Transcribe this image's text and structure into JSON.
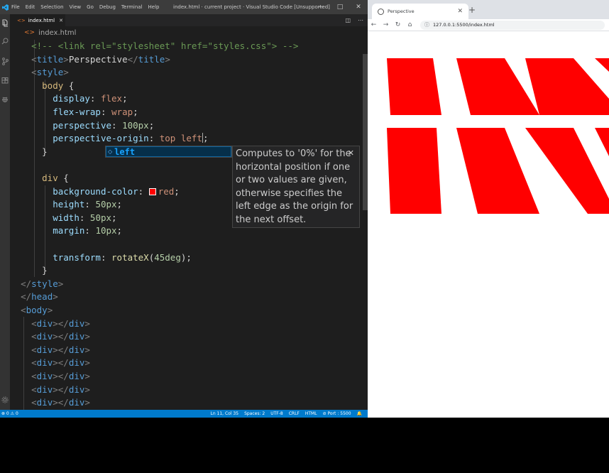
{
  "vscode": {
    "menu": [
      "File",
      "Edit",
      "Selection",
      "View",
      "Go",
      "Debug",
      "Terminal",
      "Help"
    ],
    "window_title": "index.html · current project · Visual Studio Code [Unsupported]",
    "tab": {
      "label": "index.html"
    },
    "breadcrumb": "index.html",
    "code_lines": [
      "    <!-- <link rel=\"stylesheet\" href=\"styles.css\"> -->",
      "    <title>Perspective</title>",
      "    <style>",
      "      body {",
      "        display: flex;",
      "        flex-wrap: wrap;",
      "        perspective: 100px;",
      "        perspective-origin: top left;",
      "      }",
      "",
      "      div {",
      "        background-color: red;",
      "        height: 50px;",
      "        width: 50px;",
      "        margin: 10px;",
      "",
      "        transform: rotateX(45deg);",
      "      }",
      "  </style>",
      "  </head>",
      "  <body>",
      "    <div></div>",
      "    <div></div>",
      "    <div></div>",
      "    <div></div>",
      "    <div></div>",
      "    <div></div>",
      "    <div></div>"
    ],
    "suggestion": {
      "label": "left",
      "doc": "Computes to '0%' for the horizontal position if one or two values are given, otherwise specifies the left edge as the origin for the next offset."
    },
    "status": {
      "left": "⊗ 0  ⚠ 0",
      "position": "Ln 11, Col 35",
      "spaces": "Spaces: 2",
      "encoding": "UTF-8",
      "eol": "CRLF",
      "language": "HTML",
      "port": "Port : 5500"
    }
  },
  "browser": {
    "tab_title": "Perspective",
    "url": "127.0.0.1:5500/index.html",
    "box_color": "#ff0000"
  }
}
